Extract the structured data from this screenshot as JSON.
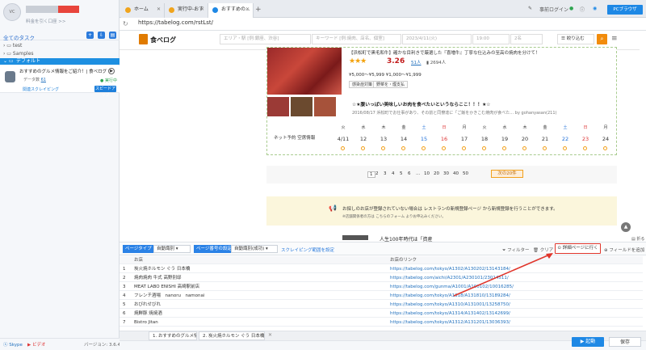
{
  "user": {
    "logo": "VC",
    "link": "料金を引く口座 >>"
  },
  "tasks": {
    "title": "全てのタスク",
    "folders": [
      "test",
      "Samples"
    ],
    "default_label": "デフォルト"
  },
  "task": {
    "name": "おすすめのグルメ情報をご紹介！| 食べログ",
    "meta1": "データ数",
    "count": "61",
    "status": "実行中",
    "meta2": "関連スクレイピング",
    "speedup": "スピードアップ"
  },
  "left_footer": {
    "skype": "Skype",
    "video": "ビデオ",
    "version": "バージョン: 3.6.4"
  },
  "tabs": [
    {
      "label": "ホーム"
    },
    {
      "label": "実行中-おす"
    },
    {
      "label": "おすすめの..."
    }
  ],
  "topbar": {
    "login": "事前ログイン",
    "pc_browser": "PCブラウザ"
  },
  "address": {
    "url": "https://tabelog.com/rstLst/"
  },
  "site": {
    "name": "食べログ",
    "area": "エリア・駅 [例:銀座、渋谷]",
    "keyword": "キーワード [例:焼肉、店名、個室]",
    "date": "2023/4/11(火)",
    "time": "19:00",
    "people": "2名",
    "narrow": "絞り込む"
  },
  "restaurant": {
    "desc": "【浜松町で黒毛和牛】確かな目利きで厳選した『喜増牛』丁寧な仕込みの至高の焼肉を分けて！",
    "stars": "★★★",
    "score": "3.26",
    "reviews": "51人",
    "bookmarks": "2694人",
    "price": "¥5,000～¥5,999   ¥1,000～¥1,999",
    "tag1": "感染症対策",
    "tag2": "野菜を・煙支払",
    "review_title": "☆★腹いっぱい美味しいお肉を食べたいというならここ！！！★☆",
    "review_meta": "2016/08/17 浜松町でお仕事があり、その前と同僚達に「ご飯をかきこむ焼肉が食べた…  by gohanyasan(211)"
  },
  "calendar": {
    "label": "ネット予約 空席情報",
    "days": [
      "火",
      "水",
      "木",
      "金",
      "土",
      "日",
      "月",
      "火",
      "水",
      "木",
      "金",
      "土",
      "日",
      "月"
    ],
    "dates": [
      "4/11",
      "12",
      "13",
      "14",
      "15",
      "16",
      "17",
      "18",
      "19",
      "20",
      "21",
      "22",
      "23",
      "24"
    ]
  },
  "pager": {
    "pages": [
      "1",
      "2",
      "3",
      "4",
      "5",
      "6",
      "…",
      "10",
      "20",
      "30",
      "40",
      "50"
    ],
    "next": "次の20件"
  },
  "notice": {
    "text": "お探しのお店が登録されていない場合は レストランの新規登録ページ から新規登録を行うことができます。",
    "sub": "※店舗関係者の方は こちらのフォーム よりお申込みください。",
    "ad": "人生100年時代は「資産"
  },
  "toolbar": {
    "page_type": "ページタイプ",
    "page_type_val": "自動識別",
    "page_num": "ページ番号の設定",
    "page_num_val": "自動識別(成功)",
    "advanced": "スクレイピング範囲を設定",
    "filter": "フィルター",
    "clear": "クリア",
    "detail": "詳細ページに行く",
    "add_field": "フィールドを追加"
  },
  "table": {
    "headers": [
      "お店",
      "お店のリンク"
    ],
    "rows": [
      {
        "n": "1",
        "name": "炭火焼ホルモン ぐう 日本橋",
        "link": "https://tabelog.com/tokyo/A1302/A130202/13143184/"
      },
      {
        "n": "2",
        "name": "焼肉焼肉 牛式 高野別邸",
        "link": "https://tabelog.com/aichi/A2301/A230101/23014511/"
      },
      {
        "n": "3",
        "name": "MEAT LABO ENISHI 高崎駅前店",
        "link": "https://tabelog.com/gunma/A1001/A100102/10016285/"
      },
      {
        "n": "4",
        "name": "フレンチ酒場　nanoru　namonai",
        "link": "https://tabelog.com/tokyo/A1318/A131810/13189284/"
      },
      {
        "n": "5",
        "name": "おびれせびれ",
        "link": "https://tabelog.com/tokyo/A1310/A131001/13258750/"
      },
      {
        "n": "6",
        "name": "焼鮮豚 焼焼酒",
        "link": "https://tabelog.com/tokyo/A1314/A131402/13142699/"
      },
      {
        "n": "7",
        "name": "Bistro Jitan",
        "link": "https://tabelog.com/tokyo/A1312/A131201/13036393/"
      }
    ]
  },
  "bottom_tabs": [
    "1. おすすめのグルメ情報をご紹介…",
    "2. 炭火焼ホルモン ぐう 日本橋 - 日…"
  ],
  "bottom": {
    "run": "▶ 起動",
    "save": "保存"
  },
  "colors": {
    "accent": "#1e88e5",
    "tabelog": "#f28c0c",
    "highlight": "#e0352b"
  }
}
